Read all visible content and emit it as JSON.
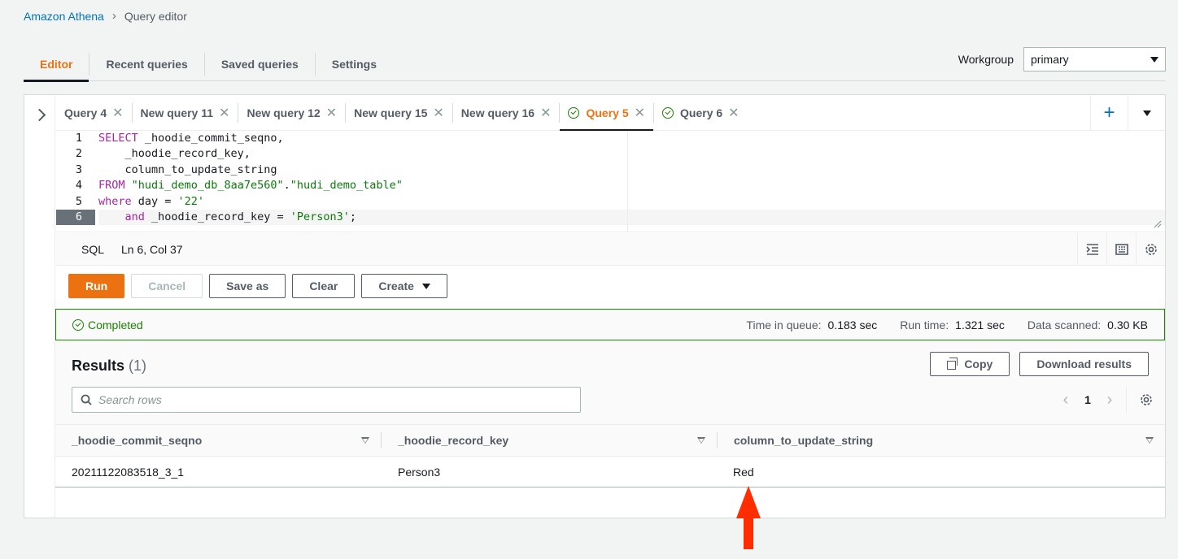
{
  "breadcrumb": {
    "root": "Amazon Athena",
    "current": "Query editor"
  },
  "main_tabs": [
    "Editor",
    "Recent queries",
    "Saved queries",
    "Settings"
  ],
  "workgroup": {
    "label": "Workgroup",
    "value": "primary"
  },
  "query_tabs": [
    {
      "label": "Query 4",
      "status": ""
    },
    {
      "label": "New query 11",
      "status": ""
    },
    {
      "label": "New query 12",
      "status": ""
    },
    {
      "label": "New query 15",
      "status": ""
    },
    {
      "label": "New query 16",
      "status": ""
    },
    {
      "label": "Query 5",
      "status": "completed"
    },
    {
      "label": "Query 6",
      "status": "completed"
    }
  ],
  "editor": {
    "line_numbers": [
      "1",
      "2",
      "3",
      "4",
      "5",
      "6"
    ],
    "lines": [
      "SELECT _hoodie_commit_seqno,",
      "    _hoodie_record_key,",
      "    column_to_update_string",
      "FROM \"hudi_demo_db_8aa7e560\".\"hudi_demo_table\"",
      "where day = '22'",
      "    and _hoodie_record_key = 'Person3';"
    ]
  },
  "status_bar": {
    "language": "SQL",
    "position": "Ln 6, Col 37"
  },
  "actions": {
    "run": "Run",
    "cancel": "Cancel",
    "save_as": "Save as",
    "clear": "Clear",
    "create": "Create"
  },
  "execution": {
    "status": "Completed",
    "time_in_queue_label": "Time in queue:",
    "time_in_queue": "0.183 sec",
    "run_time_label": "Run time:",
    "run_time": "1.321 sec",
    "data_scanned_label": "Data scanned:",
    "data_scanned": "0.30 KB"
  },
  "results": {
    "title": "Results",
    "count": "(1)",
    "copy_label": "Copy",
    "download_label": "Download results",
    "search_placeholder": "Search rows",
    "page": "1",
    "columns": [
      "_hoodie_commit_seqno",
      "_hoodie_record_key",
      "column_to_update_string"
    ],
    "rows": [
      [
        "20211122083518_3_1",
        "Person3",
        "Red"
      ]
    ]
  },
  "colors": {
    "accent": "#ec7211",
    "link": "#0073bb",
    "success": "#1d8102",
    "annotation_arrow": "#ff2d00"
  }
}
